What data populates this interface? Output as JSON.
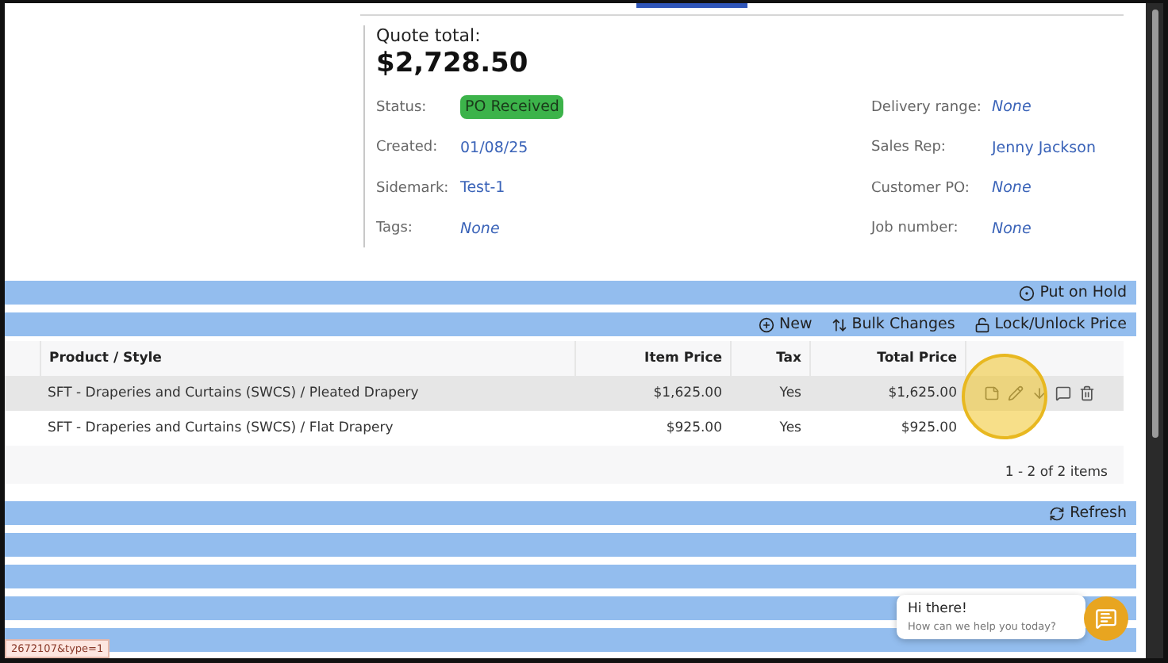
{
  "quote": {
    "total_label": "Quote total:",
    "total": "$2,728.50"
  },
  "fields_left": [
    {
      "label": "Status:",
      "value": "PO Received",
      "kind": "badge"
    },
    {
      "label": "Created:",
      "value": "01/08/25",
      "kind": "link"
    },
    {
      "label": "Sidemark:",
      "value": "Test-1",
      "kind": "link"
    },
    {
      "label": "Tags:",
      "value": "None",
      "kind": "empty"
    }
  ],
  "fields_right": [
    {
      "label": "Delivery range:",
      "value": "None",
      "kind": "empty"
    },
    {
      "label": "Sales Rep:",
      "value": "Jenny Jackson",
      "kind": "link"
    },
    {
      "label": "Customer PO:",
      "value": "None",
      "kind": "empty"
    },
    {
      "label": "Job number:",
      "value": "None",
      "kind": "empty"
    }
  ],
  "hold_bar": {
    "label": "Put on Hold"
  },
  "toolbar": [
    {
      "label": "New",
      "kind": "plus"
    },
    {
      "label": "Bulk Changes",
      "kind": "swap"
    },
    {
      "label": "Lock/Unlock Price",
      "kind": "lock"
    }
  ],
  "table": {
    "columns": [
      "Product / Style",
      "Item Price",
      "Tax",
      "Total Price"
    ],
    "rows": [
      {
        "product": "SFT - Draperies and Curtains (SWCS) / Pleated Drapery",
        "item_price": "$1,625.00",
        "tax": "Yes",
        "total": "$1,625.00",
        "selected": true
      },
      {
        "product": "SFT - Draperies and Curtains (SWCS) / Flat Drapery",
        "item_price": "$925.00",
        "tax": "Yes",
        "total": "$925.00",
        "selected": false
      }
    ],
    "pager": "1 - 2 of 2 items"
  },
  "refresh_bar": {
    "label": "Refresh"
  },
  "chat": {
    "greeting": "Hi there!",
    "prompt": "How can we help you today?"
  },
  "status_url": "2672107&type=1"
}
